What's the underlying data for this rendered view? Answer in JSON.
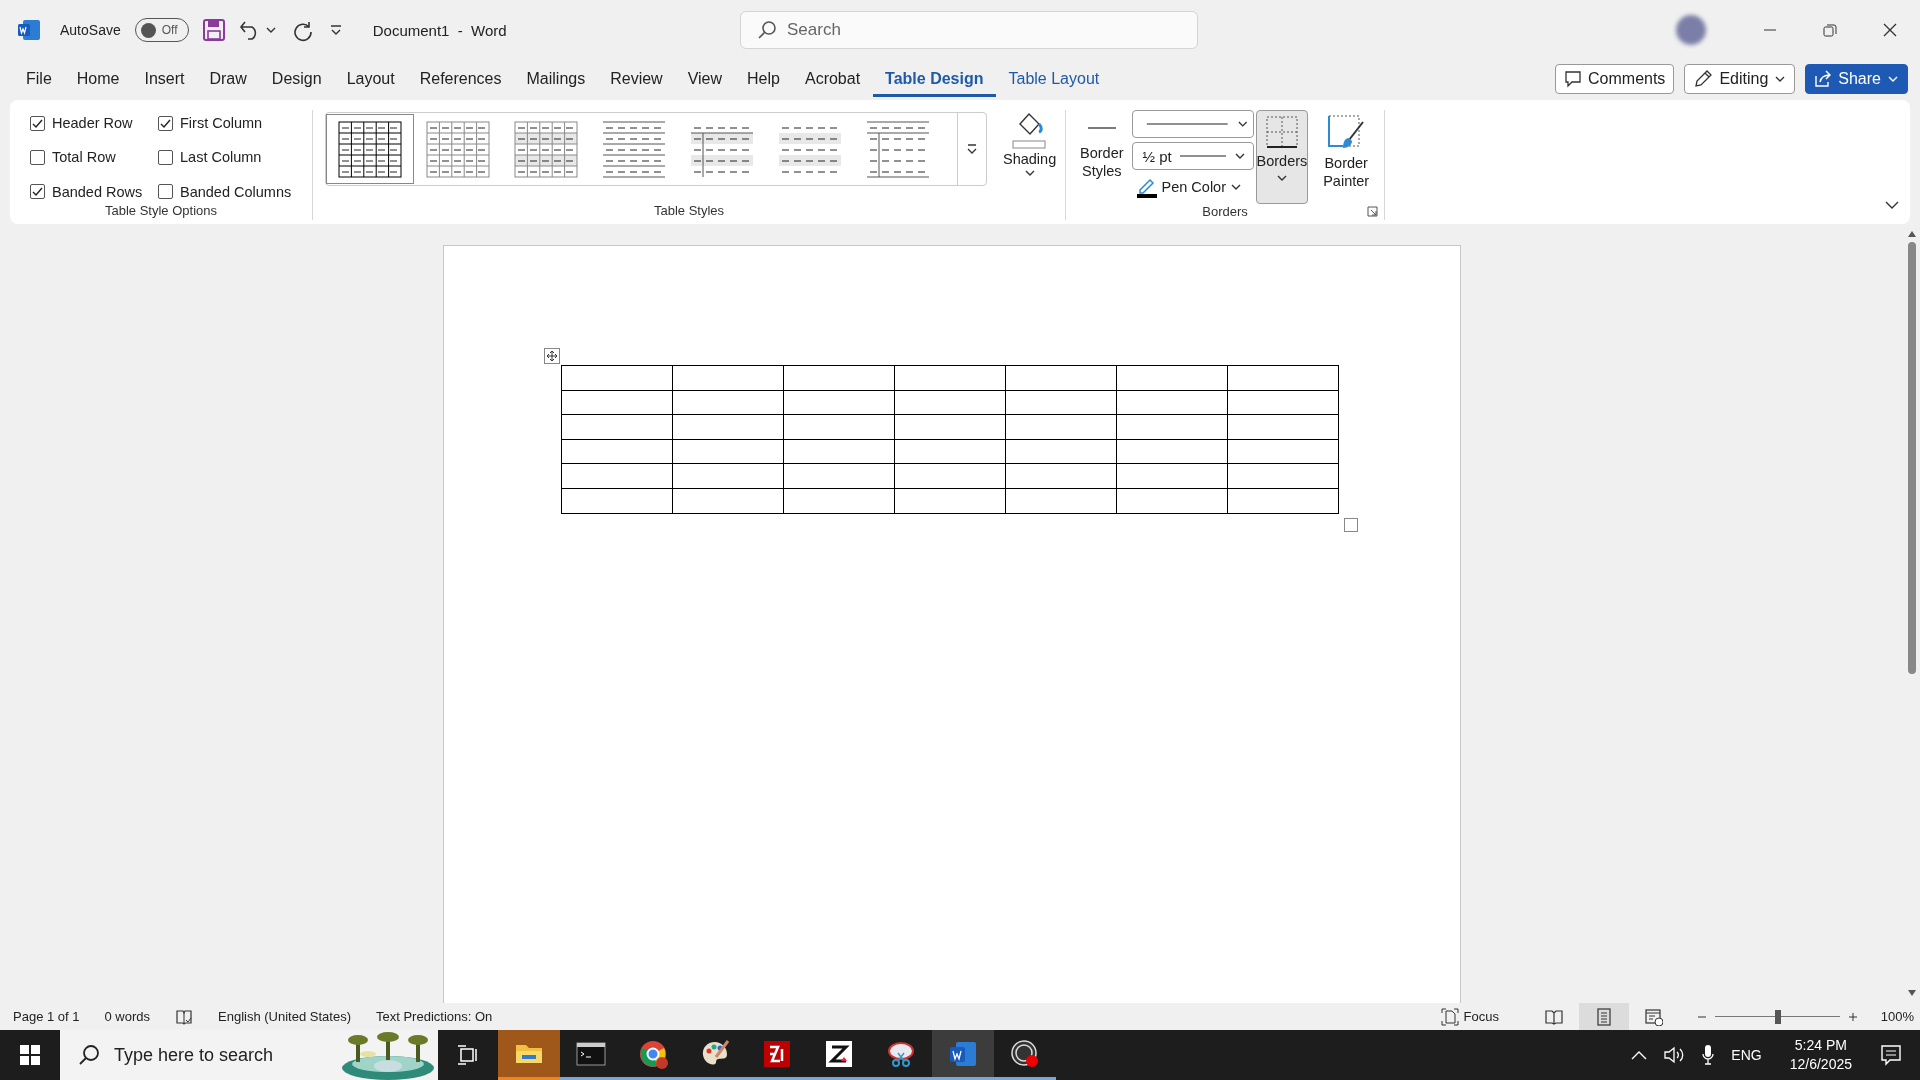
{
  "title_bar": {
    "autosave": {
      "label": "AutoSave",
      "state_text": "Off",
      "on": false
    },
    "document_title": "Document1  -  Word",
    "search": {
      "placeholder": "Search"
    }
  },
  "menu_tabs": [
    {
      "label": "File",
      "selected": false,
      "contextual": false
    },
    {
      "label": "Home",
      "selected": false,
      "contextual": false
    },
    {
      "label": "Insert",
      "selected": false,
      "contextual": false
    },
    {
      "label": "Draw",
      "selected": false,
      "contextual": false
    },
    {
      "label": "Design",
      "selected": false,
      "contextual": false
    },
    {
      "label": "Layout",
      "selected": false,
      "contextual": false
    },
    {
      "label": "References",
      "selected": false,
      "contextual": false
    },
    {
      "label": "Mailings",
      "selected": false,
      "contextual": false
    },
    {
      "label": "Review",
      "selected": false,
      "contextual": false
    },
    {
      "label": "View",
      "selected": false,
      "contextual": false
    },
    {
      "label": "Help",
      "selected": false,
      "contextual": false
    },
    {
      "label": "Acrobat",
      "selected": false,
      "contextual": false
    },
    {
      "label": "Table Design",
      "selected": true,
      "contextual": true
    },
    {
      "label": "Table Layout",
      "selected": false,
      "contextual": true
    }
  ],
  "header_buttons": {
    "comments": "Comments",
    "editing": "Editing",
    "share": "Share"
  },
  "ribbon": {
    "table_style_options": {
      "label": "Table Style Options",
      "options": [
        {
          "label": "Header Row",
          "checked": true
        },
        {
          "label": "First Column",
          "checked": true
        },
        {
          "label": "Total Row",
          "checked": false
        },
        {
          "label": "Last Column",
          "checked": false
        },
        {
          "label": "Banded Rows",
          "checked": true
        },
        {
          "label": "Banded Columns",
          "checked": false
        }
      ]
    },
    "table_styles": {
      "label": "Table Styles",
      "styles": [
        {
          "kind": "grid",
          "selected": true
        },
        {
          "kind": "light-grid",
          "selected": false
        },
        {
          "kind": "banded-grid",
          "selected": false
        },
        {
          "kind": "lines",
          "selected": false
        },
        {
          "kind": "first-col-banded",
          "selected": false
        },
        {
          "kind": "banded",
          "selected": false
        },
        {
          "kind": "first-col-lines",
          "selected": false
        }
      ],
      "shading": "Shading"
    },
    "borders": {
      "label": "Borders",
      "border_styles": "Border Styles",
      "weight": "½ pt",
      "pen_color": "Pen Color",
      "borders_button": {
        "label": "Borders",
        "selected": true
      },
      "border_painter": "Border Painter"
    }
  },
  "status_bar": {
    "left": [
      "Page 1 of 1",
      "0 words",
      "English (United States)",
      "Text Predictions: On"
    ],
    "focus": "Focus",
    "views": [
      {
        "kind": "read",
        "selected": false
      },
      {
        "kind": "print",
        "selected": true
      },
      {
        "kind": "web",
        "selected": false
      }
    ],
    "zoom": {
      "level": 0.5,
      "reading": "100%"
    }
  },
  "taskbar": {
    "search": {
      "placeholder": "Type here to search"
    },
    "apps": [
      {
        "kind": "explorer",
        "flashing": true,
        "active": false
      },
      {
        "kind": "terminal",
        "flashing": false,
        "active": false
      },
      {
        "kind": "browser",
        "flashing": false,
        "active": false
      },
      {
        "kind": "paint",
        "flashing": false,
        "active": false
      },
      {
        "kind": "filezilla",
        "flashing": false,
        "active": false
      },
      {
        "kind": "zapp",
        "flashing": false,
        "active": false
      },
      {
        "kind": "snip",
        "flashing": false,
        "active": false
      },
      {
        "kind": "word",
        "flashing": false,
        "active": true
      },
      {
        "kind": "obs",
        "flashing": false,
        "active": false
      }
    ],
    "tray": {
      "language": "ENG",
      "time": "5:24 PM",
      "date": "12/6/2025"
    }
  }
}
